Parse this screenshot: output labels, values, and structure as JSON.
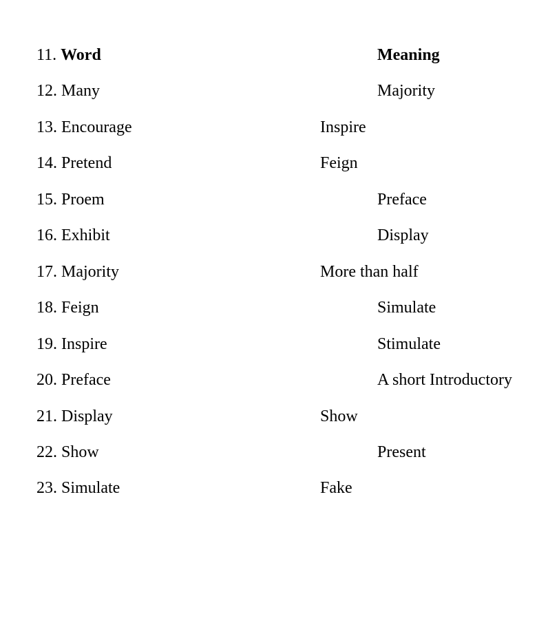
{
  "rows": [
    {
      "num": "11.",
      "word": "Word",
      "meaning": "Meaning",
      "header": true,
      "indent": 1
    },
    {
      "num": "12.",
      "word": "Many",
      "meaning": "Majority",
      "indent": 1
    },
    {
      "num": "13.",
      "word": "Encourage",
      "meaning": "Inspire",
      "indent": 0
    },
    {
      "num": "14.",
      "word": "Pretend",
      "meaning": "Feign",
      "indent": 0
    },
    {
      "num": "15.",
      "word": "Proem",
      "meaning": "Preface",
      "indent": 1
    },
    {
      "num": "16.",
      "word": "Exhibit",
      "meaning": "Display",
      "indent": 1
    },
    {
      "num": "17.",
      "word": "Majority",
      "meaning": "More than half",
      "indent": 0
    },
    {
      "num": "18.",
      "word": "Feign",
      "meaning": "Simulate",
      "indent": 1
    },
    {
      "num": "19.",
      "word": "Inspire",
      "meaning": "Stimulate",
      "indent": 1
    },
    {
      "num": "20.",
      "word": "Preface",
      "meaning": "A short Introductory",
      "indent": 1
    },
    {
      "num": "21.",
      "word": "Display",
      "meaning": "Show",
      "indent": 0
    },
    {
      "num": "22.",
      "word": "Show",
      "meaning": "Present",
      "indent": 1
    },
    {
      "num": "23.",
      "word": "Simulate",
      "meaning": "Fake",
      "indent": 0
    }
  ]
}
